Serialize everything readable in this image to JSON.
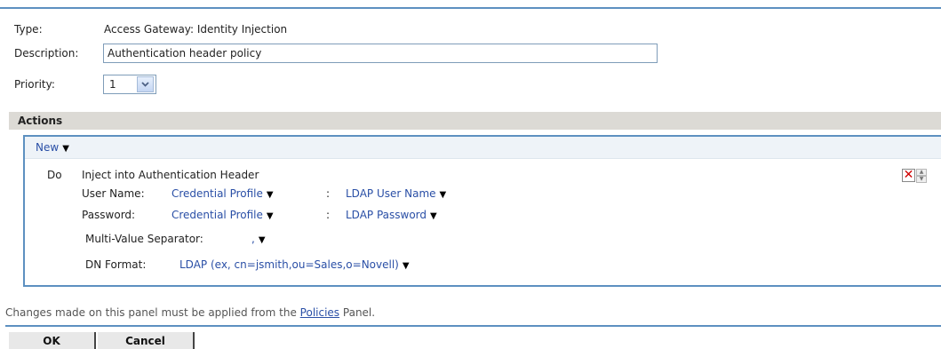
{
  "form": {
    "type_label": "Type:",
    "type_value": "Access Gateway: Identity Injection",
    "description_label": "Description:",
    "description_value": "Authentication header policy",
    "priority_label": "Priority:",
    "priority_value": "1"
  },
  "actions": {
    "header": "Actions",
    "new_label": "New",
    "do_label": "Do",
    "action_title": "Inject into Authentication Header",
    "username_label": "User Name:",
    "username_source": "Credential Profile",
    "username_sep": ":",
    "username_value": "LDAP User Name",
    "password_label": "Password:",
    "password_source": "Credential Profile",
    "password_sep": ":",
    "password_value": "LDAP Password",
    "separator_label": "Multi-Value Separator:",
    "separator_value": ",",
    "dn_label": "DN Format:",
    "dn_value": "LDAP (ex, cn=jsmith,ou=Sales,o=Novell)"
  },
  "footer": {
    "note_before": "Changes made on this panel must be applied from the",
    "note_link": "Policies",
    "note_after": "Panel.",
    "ok_label": "OK",
    "cancel_label": "Cancel"
  }
}
